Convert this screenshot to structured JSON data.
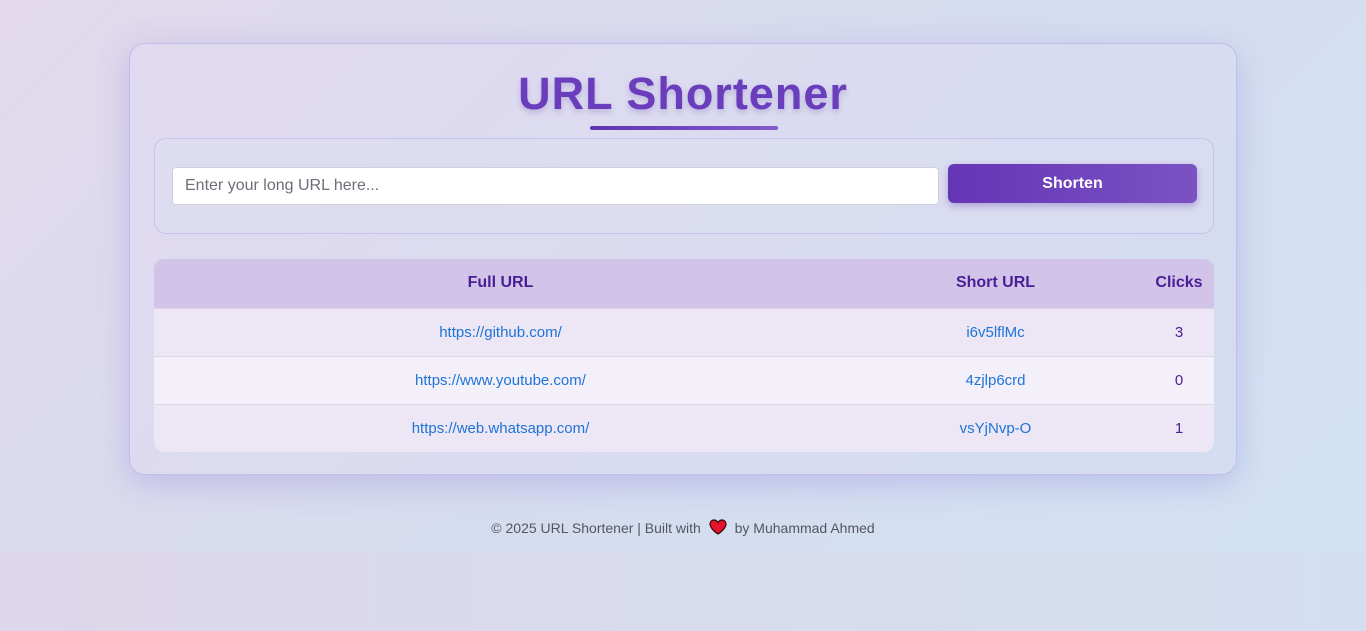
{
  "header": {
    "title": "URL Shortener"
  },
  "form": {
    "input_placeholder": "Enter your long URL here...",
    "button_label": "Shorten"
  },
  "table": {
    "columns": [
      "Full URL",
      "Short URL",
      "Clicks"
    ],
    "rows": [
      {
        "full_url": "https://github.com/",
        "short_url": "i6v5lflMc",
        "clicks": "3"
      },
      {
        "full_url": "https://www.youtube.com/",
        "short_url": "4zjlp6crd",
        "clicks": "0"
      },
      {
        "full_url": "https://web.whatsapp.com/",
        "short_url": "vsYjNvp-O",
        "clicks": "1"
      }
    ]
  },
  "footer": {
    "prefix": "© 2025 URL Shortener | Built with",
    "heart_icon": "heart-icon",
    "suffix": "by Muhammad Ahmed"
  },
  "colors": {
    "accent": "#6535b6",
    "title": "#6a3dbd",
    "link": "#1e74d8",
    "header_text": "#4a1e96"
  }
}
